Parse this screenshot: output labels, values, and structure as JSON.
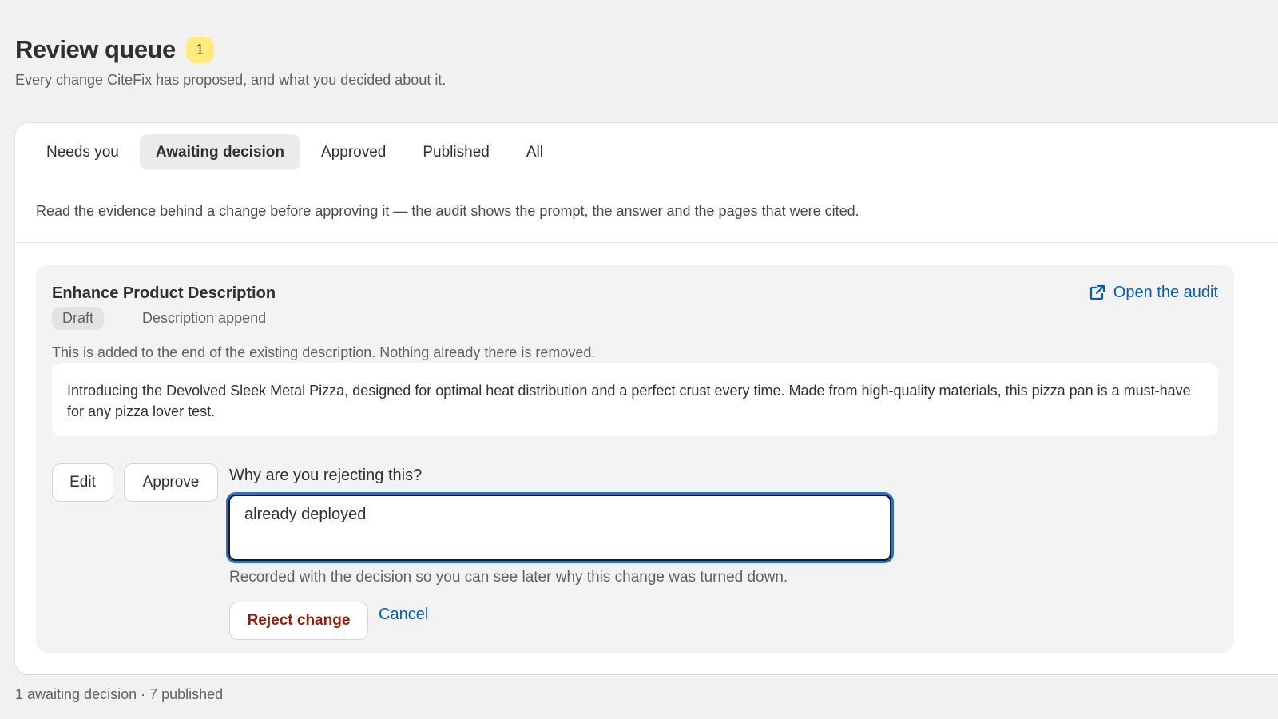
{
  "header": {
    "title": "Review queue",
    "count": "1",
    "subtitle": "Every change CiteFix has proposed, and what you decided about it."
  },
  "tabs": [
    {
      "label": "Needs you",
      "active": false
    },
    {
      "label": "Awaiting decision",
      "active": true
    },
    {
      "label": "Approved",
      "active": false
    },
    {
      "label": "Published",
      "active": false
    },
    {
      "label": "All",
      "active": false
    }
  ],
  "hint": "Read the evidence behind a change before approving it — the audit shows the prompt, the answer and the pages that were cited.",
  "item": {
    "title": "Enhance Product Description",
    "status": "Draft",
    "change_type": "Description append",
    "open_audit_label": "Open the audit",
    "open_audit_icon": "external-link-icon",
    "note": "This is added to the end of the existing description. Nothing already there is removed.",
    "description": "Introducing the Devolved Sleek Metal Pizza, designed for optimal heat distribution and a perfect crust every time. Made from high-quality materials, this pizza pan is a must-have for any pizza lover test.",
    "actions": {
      "edit": "Edit",
      "approve": "Approve"
    },
    "reject_form": {
      "label": "Why are you rejecting this?",
      "value": "already deployed",
      "help": "Recorded with the decision so you can see later why this change was turned down.",
      "reject": "Reject change",
      "cancel": "Cancel"
    }
  },
  "footer": "1 awaiting decision · 7 published",
  "colors": {
    "accent": "#005bd3",
    "badge": "#ffeb78",
    "critical": "#8e1f0b",
    "focus": "#2c6ecb"
  }
}
